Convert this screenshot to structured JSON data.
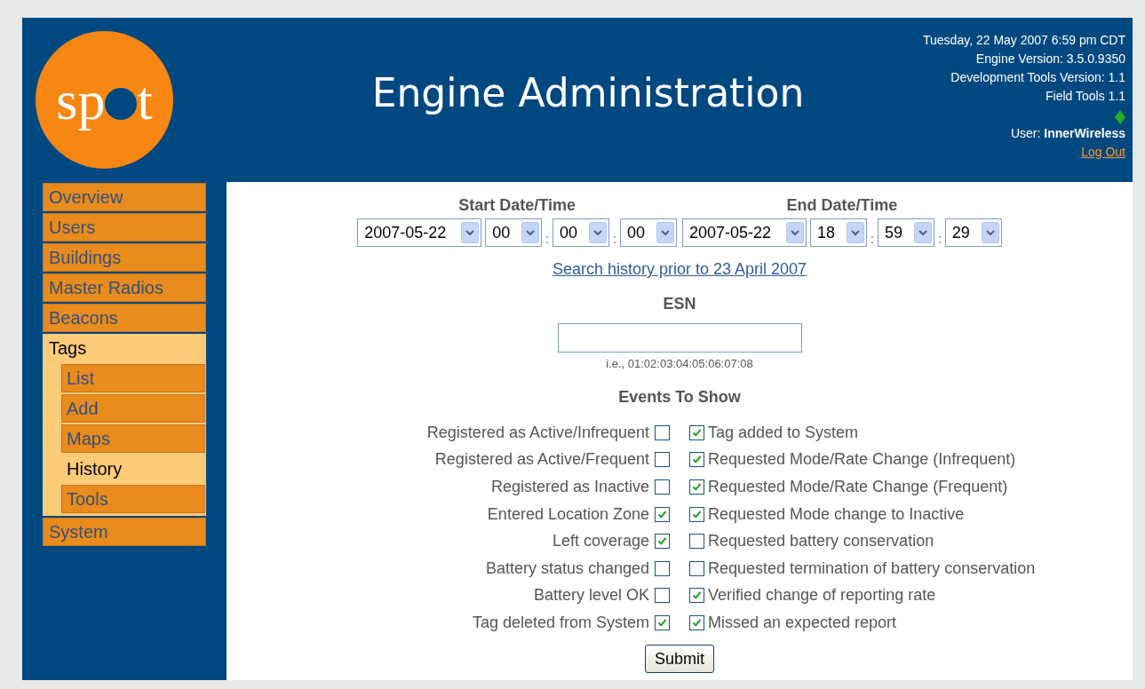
{
  "logo": {
    "before": "sp",
    "after": "t"
  },
  "header": {
    "title": "Engine Administration",
    "info": [
      "Tuesday, 22 May 2007 6:59 pm CDT",
      "Engine Version: 3.5.0.9350",
      "Development Tools Version: 1.1",
      "Field Tools 1.1"
    ],
    "user_label": "User:",
    "user_name": "InnerWireless",
    "logout": "Log Out"
  },
  "sidebar": {
    "items": [
      {
        "label": "Overview",
        "selected": false
      },
      {
        "label": "Users",
        "selected": false
      },
      {
        "label": "Buildings",
        "selected": false
      },
      {
        "label": "Master Radios",
        "selected": false
      },
      {
        "label": "Beacons",
        "selected": false
      },
      {
        "label": "Tags",
        "selected": true,
        "children": [
          {
            "label": "List",
            "selected": false
          },
          {
            "label": "Add",
            "selected": false
          },
          {
            "label": "Maps",
            "selected": false
          },
          {
            "label": "History",
            "selected": true
          },
          {
            "label": "Tools",
            "selected": false
          }
        ]
      },
      {
        "label": "System",
        "selected": false
      }
    ]
  },
  "range": [
    {
      "label": "Start Date/Time",
      "date": "2007-05-22",
      "hour": "00",
      "minute": "00",
      "second": "00"
    },
    {
      "label": "End Date/Time",
      "date": "2007-05-22",
      "hour": "18",
      "minute": "59",
      "second": "29"
    }
  ],
  "time_separator": ":",
  "history_link": "Search history prior to 23 April 2007",
  "esn": {
    "label": "ESN",
    "hint": "i.e., 01:02:03:04:05:06:07:08"
  },
  "events_title": "Events To Show",
  "events_left": [
    {
      "label": "Registered as Active/Infrequent",
      "checked": false
    },
    {
      "label": "Registered as Active/Frequent",
      "checked": false
    },
    {
      "label": "Registered as Inactive",
      "checked": false
    },
    {
      "label": "Entered Location Zone",
      "checked": true
    },
    {
      "label": "Left coverage",
      "checked": true
    },
    {
      "label": "Battery status changed",
      "checked": false
    },
    {
      "label": "Battery level OK",
      "checked": false
    },
    {
      "label": "Tag deleted from System",
      "checked": true
    }
  ],
  "events_right": [
    {
      "label": "Tag added to System",
      "checked": true
    },
    {
      "label": "Requested Mode/Rate Change (Infrequent)",
      "checked": true
    },
    {
      "label": "Requested Mode/Rate Change (Frequent)",
      "checked": true
    },
    {
      "label": "Requested Mode change to Inactive",
      "checked": true
    },
    {
      "label": "Requested battery conservation",
      "checked": false
    },
    {
      "label": "Requested termination of battery conservation",
      "checked": false
    },
    {
      "label": "Verified change of reporting rate",
      "checked": true
    },
    {
      "label": "Missed an expected report",
      "checked": true
    }
  ],
  "submit": "Submit"
}
